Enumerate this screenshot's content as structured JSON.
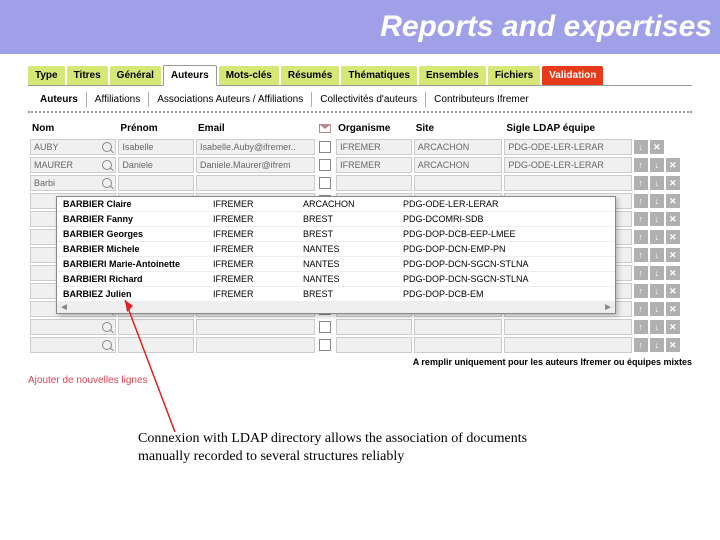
{
  "banner": {
    "title": "Reports and expertises"
  },
  "tabs": {
    "items": [
      {
        "label": "Type"
      },
      {
        "label": "Titres"
      },
      {
        "label": "Général"
      },
      {
        "label": "Auteurs",
        "active": true
      },
      {
        "label": "Mots-clés"
      },
      {
        "label": "Résumés"
      },
      {
        "label": "Thématiques"
      },
      {
        "label": "Ensembles"
      },
      {
        "label": "Fichiers"
      },
      {
        "label": "Validation",
        "red": true
      }
    ]
  },
  "subtabs": {
    "items": [
      {
        "label": "Auteurs",
        "active": true
      },
      {
        "label": "Affiliations"
      },
      {
        "label": "Associations Auteurs / Affiliations"
      },
      {
        "label": "Collectivités d'auteurs"
      },
      {
        "label": "Contributeurs Ifremer"
      }
    ]
  },
  "columns": {
    "nom": "Nom",
    "prenom": "Prénom",
    "email": "Email",
    "organisme": "Organisme",
    "site": "Site",
    "sigle": "Sigle LDAP équipe"
  },
  "rows": [
    {
      "nom": "AUBY",
      "prenom": "Isabelle",
      "email": "Isabelle.Auby@ifremer..",
      "org": "IFREMER",
      "site": "ARCACHON",
      "sigle": "PDG-ODE-LER-LERAR"
    },
    {
      "nom": "MAURER",
      "prenom": "Daniele",
      "email": "Daniele.Maurer@ifrem",
      "org": "IFREMER",
      "site": "ARCACHON",
      "sigle": "PDG-ODE-LER-LERAR"
    },
    {
      "nom": "Barbi",
      "prenom": "",
      "email": "",
      "org": "",
      "site": "",
      "sigle": ""
    },
    {
      "nom": "",
      "prenom": "",
      "email": "",
      "org": "",
      "site": "",
      "sigle": ""
    },
    {
      "nom": "",
      "prenom": "",
      "email": "",
      "org": "",
      "site": "",
      "sigle": ""
    },
    {
      "nom": "",
      "prenom": "",
      "email": "",
      "org": "",
      "site": "",
      "sigle": ""
    },
    {
      "nom": "",
      "prenom": "",
      "email": "",
      "org": "",
      "site": "",
      "sigle": ""
    },
    {
      "nom": "",
      "prenom": "",
      "email": "",
      "org": "",
      "site": "",
      "sigle": ""
    },
    {
      "nom": "",
      "prenom": "",
      "email": "",
      "org": "",
      "site": "",
      "sigle": ""
    },
    {
      "nom": "",
      "prenom": "",
      "email": "",
      "org": "",
      "site": "",
      "sigle": ""
    },
    {
      "nom": "",
      "prenom": "",
      "email": "",
      "org": "",
      "site": "",
      "sigle": ""
    },
    {
      "nom": "",
      "prenom": "",
      "email": "",
      "org": "",
      "site": "",
      "sigle": ""
    }
  ],
  "dropdown": {
    "items": [
      {
        "name": "BARBIER Claire",
        "org": "IFREMER",
        "site": "ARCACHON",
        "sigle": "PDG-ODE-LER-LERAR"
      },
      {
        "name": "BARBIER Fanny",
        "org": "IFREMER",
        "site": "BREST",
        "sigle": "PDG-DCOMRI-SDB"
      },
      {
        "name": "BARBIER Georges",
        "org": "IFREMER",
        "site": "BREST",
        "sigle": "PDG-DOP-DCB-EEP-LMEE"
      },
      {
        "name": "BARBIER Michele",
        "org": "IFREMER",
        "site": "NANTES",
        "sigle": "PDG-DOP-DCN-EMP-PN"
      },
      {
        "name": "BARBIERI Marie-Antoinette",
        "org": "IFREMER",
        "site": "NANTES",
        "sigle": "PDG-DOP-DCN-SGCN-STLNA"
      },
      {
        "name": "BARBIERI Richard",
        "org": "IFREMER",
        "site": "NANTES",
        "sigle": "PDG-DOP-DCN-SGCN-STLNA"
      },
      {
        "name": "BARBIEZ Julien",
        "org": "IFREMER",
        "site": "BREST",
        "sigle": "PDG-DOP-DCB-EM"
      }
    ],
    "scroll_left": "◄",
    "scroll_right": "►"
  },
  "footnote": "A remplir uniquement pour les auteurs Ifremer ou équipes mixtes",
  "addlink": "Ajouter de nouvelles lignes",
  "action_icons": {
    "up": "↑",
    "down": "↓",
    "del": "✕"
  },
  "caption": "Connexion with LDAP directory allows the association of documents manually recorded to several structures reliably"
}
